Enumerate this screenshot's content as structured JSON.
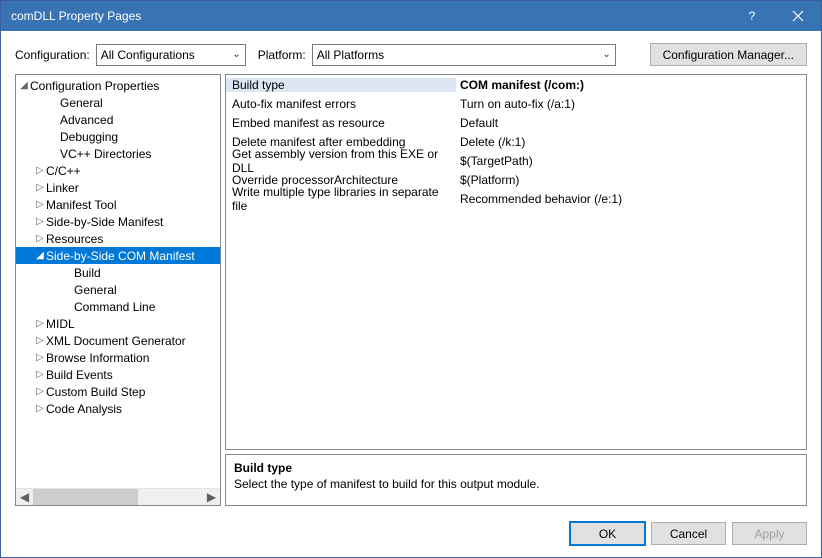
{
  "title": "comDLL Property Pages",
  "toolbar": {
    "config_label": "Configuration:",
    "config_value": "All Configurations",
    "platform_label": "Platform:",
    "platform_value": "All Platforms",
    "cfgmgr_label": "Configuration Manager..."
  },
  "tree": {
    "root": "Configuration Properties",
    "items": [
      {
        "label": "General",
        "tw": "",
        "indent": 2
      },
      {
        "label": "Advanced",
        "tw": "",
        "indent": 2
      },
      {
        "label": "Debugging",
        "tw": "",
        "indent": 2
      },
      {
        "label": "VC++ Directories",
        "tw": "",
        "indent": 2
      },
      {
        "label": "C/C++",
        "tw": "▷",
        "indent": 1
      },
      {
        "label": "Linker",
        "tw": "▷",
        "indent": 1
      },
      {
        "label": "Manifest Tool",
        "tw": "▷",
        "indent": 1
      },
      {
        "label": "Side-by-Side Manifest",
        "tw": "▷",
        "indent": 1
      },
      {
        "label": "Resources",
        "tw": "▷",
        "indent": 1
      },
      {
        "label": "Side-by-Side COM Manifest",
        "tw": "◢",
        "indent": 1,
        "selected": true
      },
      {
        "label": "Build",
        "tw": "",
        "indent": 3
      },
      {
        "label": "General",
        "tw": "",
        "indent": 3
      },
      {
        "label": "Command Line",
        "tw": "",
        "indent": 3
      },
      {
        "label": "MIDL",
        "tw": "▷",
        "indent": 1
      },
      {
        "label": "XML Document Generator",
        "tw": "▷",
        "indent": 1
      },
      {
        "label": "Browse Information",
        "tw": "▷",
        "indent": 1
      },
      {
        "label": "Build Events",
        "tw": "▷",
        "indent": 1
      },
      {
        "label": "Custom Build Step",
        "tw": "▷",
        "indent": 1
      },
      {
        "label": "Code Analysis",
        "tw": "▷",
        "indent": 1
      }
    ]
  },
  "grid": [
    {
      "k": "Build type",
      "v": "COM manifest (/com:)",
      "selected": true
    },
    {
      "k": "Auto-fix manifest errors",
      "v": "Turn on auto-fix (/a:1)"
    },
    {
      "k": "Embed manifest as resource",
      "v": "Default"
    },
    {
      "k": "Delete manifest after embedding",
      "v": "Delete (/k:1)"
    },
    {
      "k": "Get assembly version from this EXE or DLL",
      "v": "$(TargetPath)"
    },
    {
      "k": "Override processorArchitecture",
      "v": "$(Platform)"
    },
    {
      "k": "Write multiple type libraries in separate file",
      "v": "Recommended behavior (/e:1)"
    }
  ],
  "desc": {
    "title": "Build type",
    "body": "Select the type of manifest to build for this output module."
  },
  "footer": {
    "ok": "OK",
    "cancel": "Cancel",
    "apply": "Apply"
  },
  "glyphs": {
    "root_tw": "◢",
    "combo_arrow": "⌄",
    "left": "◀",
    "right": "▶"
  }
}
